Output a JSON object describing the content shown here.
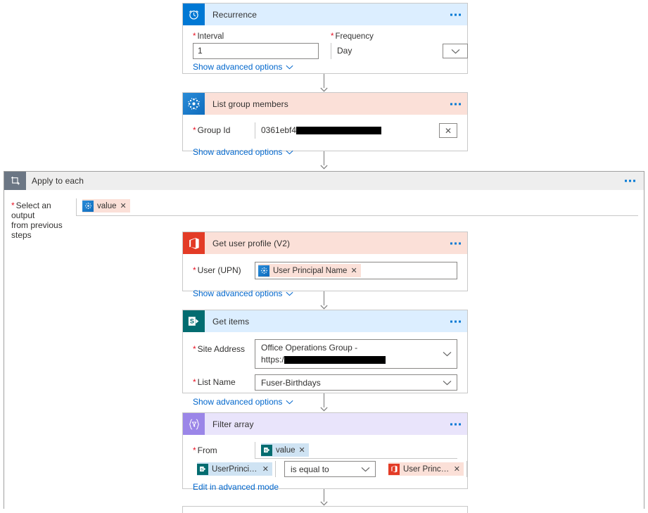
{
  "colors": {
    "accent": "#0078d4",
    "required": "#e81123",
    "link": "#0066cc",
    "header_blue": "#dceeff",
    "header_pink": "#fbe0d8",
    "header_purple": "#e9e4fb",
    "office_red": "#e33b26",
    "sharepoint_teal": "#036c70",
    "scope_gray": "#6b7684"
  },
  "labels": {
    "show_advanced": "Show advanced options",
    "edit_advanced": "Edit in advanced mode",
    "more_commands": "…"
  },
  "cards": {
    "recurrence": {
      "title": "Recurrence",
      "icon": "alarm-clock-icon",
      "fields": {
        "interval_label": "Interval",
        "interval_value": "1",
        "frequency_label": "Frequency",
        "frequency_value": "Day"
      }
    },
    "list_group_members": {
      "title": "List group members",
      "icon": "azure-ad-icon",
      "fields": {
        "group_id_label": "Group Id",
        "group_id_value": "0361ebf4",
        "group_id_redacted": true
      }
    },
    "apply_to_each": {
      "title": "Apply to each",
      "icon": "loop-icon",
      "fields": {
        "output_label_line1": "Select an output",
        "output_label_line2": "from previous steps",
        "output_token": "value",
        "output_token_icon": "azure-ad-icon"
      }
    },
    "get_user_profile": {
      "title": "Get user profile (V2)",
      "icon": "office365-icon",
      "fields": {
        "user_label": "User (UPN)",
        "user_token": "User Principal Name",
        "user_token_icon": "azure-ad-icon"
      }
    },
    "get_items": {
      "title": "Get items",
      "icon": "sharepoint-icon",
      "fields": {
        "site_address_label": "Site Address",
        "site_address_line1": "Office Operations Group -",
        "site_address_line2": "https:/",
        "site_address_redacted": true,
        "list_name_label": "List Name",
        "list_name_value": "Fuser-Birthdays"
      }
    },
    "filter_array": {
      "title": "Filter array",
      "icon": "filter-braces-icon",
      "fields": {
        "from_label": "From",
        "from_token": "value",
        "from_token_icon": "sharepoint-icon",
        "condition_left_token": "UserPrincipal...",
        "condition_left_icon": "sharepoint-icon",
        "condition_operator": "is equal to",
        "condition_right_token": "User Principa...",
        "condition_right_icon": "office365-icon"
      }
    }
  }
}
